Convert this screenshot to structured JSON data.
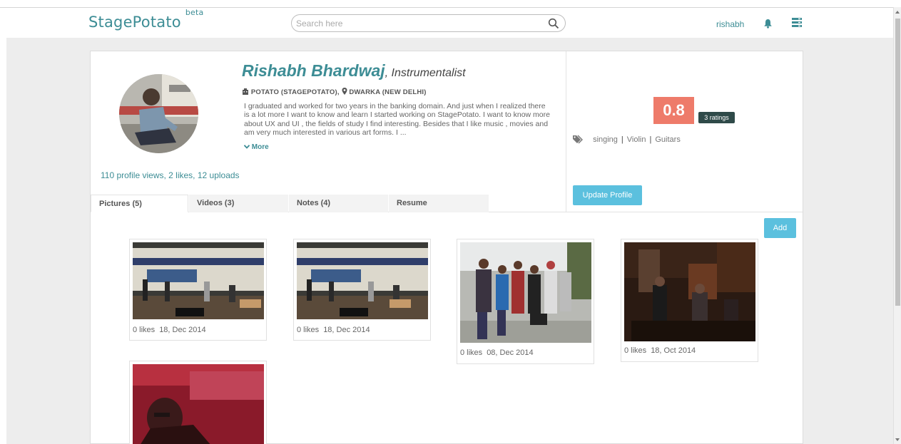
{
  "header": {
    "logo": "StagePotato",
    "logo_badge": "beta",
    "search_placeholder": "Search here",
    "username": "rishabh"
  },
  "profile": {
    "name": "Rishabh Bhardwaj",
    "role": ", Instrumentalist",
    "org": "POTATO (STAGEPOTATO),",
    "location": "DWARKA (NEW DELHI)",
    "bio": "I graduated and worked for two years in the banking domain. And just when I realized there is a lot more I want to know and learn I started working on StagePotato. I want to know more about UX and UI , the fields of study I find interesting. Besides that I like music , movies and am very much interested in various art forms. I ...",
    "more_label": "More",
    "stats": "110 profile views, 2 likes, 12 uploads",
    "rating": "0.8",
    "ratings_count": "3 ratings",
    "tags": [
      "singing",
      "Violin",
      "Guitars"
    ],
    "update_label": "Update Profile"
  },
  "tabs": [
    {
      "label": "Pictures (5)",
      "active": true
    },
    {
      "label": "Videos (3)"
    },
    {
      "label": "Notes (4)"
    },
    {
      "label": "Resume"
    }
  ],
  "add_label": "Add",
  "pictures": [
    {
      "likes": "0 likes",
      "date": "18, Dec 2014"
    },
    {
      "likes": "0 likes",
      "date": "18, Dec 2014"
    },
    {
      "likes": "0 likes",
      "date": "08, Dec 2014"
    },
    {
      "likes": "0 likes",
      "date": "18, Oct 2014"
    },
    {
      "likes": "",
      "date": ""
    }
  ],
  "colors": {
    "brand": "#3d8d95",
    "rating_bg": "#ee7b6a",
    "button": "#5bc0de",
    "badge_bg": "#2f4a49"
  }
}
